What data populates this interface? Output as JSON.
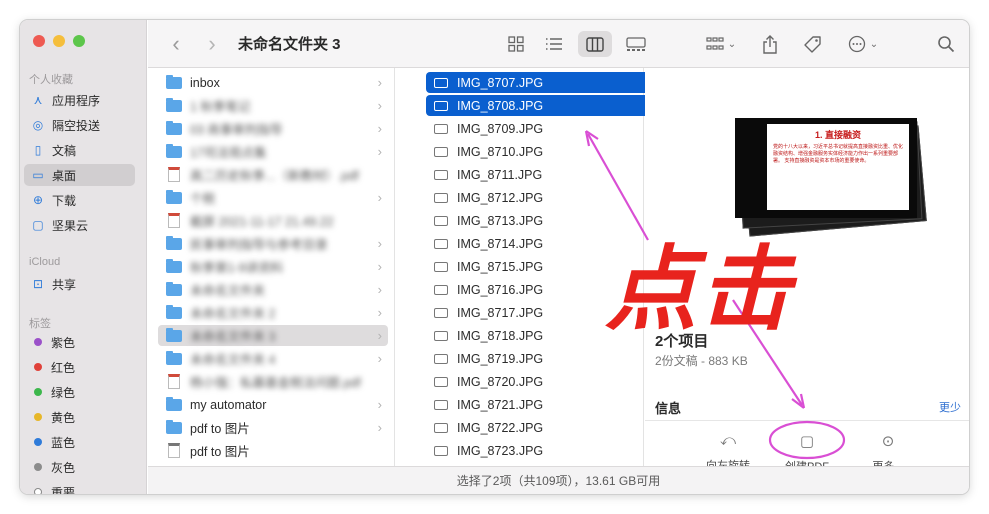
{
  "sidebar": {
    "favorites_header": "个人收藏",
    "favorites": [
      {
        "label": "应用程序",
        "icon": "apps-icon"
      },
      {
        "label": "隔空投送",
        "icon": "airdrop-icon"
      },
      {
        "label": "文稿",
        "icon": "document-icon"
      },
      {
        "label": "桌面",
        "icon": "desktop-icon"
      },
      {
        "label": "下载",
        "icon": "download-icon"
      },
      {
        "label": "坚果云",
        "icon": "folder-icon"
      }
    ],
    "icloud_header": "iCloud",
    "icloud": [
      {
        "label": "共享",
        "icon": "shared-folder-icon"
      }
    ],
    "tags_header": "标签",
    "tags": [
      {
        "label": "紫色",
        "color": "#9b51c9"
      },
      {
        "label": "红色",
        "color": "#e0413a"
      },
      {
        "label": "绿色",
        "color": "#3db74c"
      },
      {
        "label": "黄色",
        "color": "#e7b72a"
      },
      {
        "label": "蓝色",
        "color": "#2f7bd9"
      },
      {
        "label": "灰色",
        "color": "#8c8c8c"
      },
      {
        "label": "重要",
        "color": "#ffffff"
      }
    ]
  },
  "toolbar": {
    "title": "未命名文件夹 3"
  },
  "column1": [
    {
      "label": "inbox",
      "type": "folder",
      "blurred": false
    },
    {
      "label": "1 秋季笔记",
      "type": "folder",
      "blurred": true
    },
    {
      "label": "03 商事审判指导",
      "type": "folder",
      "blurred": true
    },
    {
      "label": "17司法观点集",
      "type": "folder",
      "blurred": true
    },
    {
      "label": "高二历史秋季...（新教材）.pdf",
      "type": "pdf",
      "blurred": true
    },
    {
      "label": "个税",
      "type": "folder",
      "blurred": true
    },
    {
      "label": "截屏 2021-11-17 21.49.22",
      "type": "pdf",
      "blurred": true
    },
    {
      "label": "民事审判指导与参考目录",
      "type": "folder",
      "blurred": true
    },
    {
      "label": "秋季第1-9讲资料",
      "type": "folder",
      "blurred": true
    },
    {
      "label": "未命名文件夹",
      "type": "folder",
      "blurred": true
    },
    {
      "label": "未命名文件夹 2",
      "type": "folder",
      "blurred": true
    },
    {
      "label": "未命名文件夹 3",
      "type": "folder",
      "blurred": true,
      "selected": true
    },
    {
      "label": "未命名文件夹 4",
      "type": "folder",
      "blurred": true
    },
    {
      "label": "杨小强：私募基金税法问题.pdf",
      "type": "pdf",
      "blurred": true
    },
    {
      "label": "my automator",
      "type": "folder",
      "blurred": false
    },
    {
      "label": "pdf to 图片",
      "type": "folder",
      "blurred": false
    },
    {
      "label": "pdf to 图片",
      "type": "app",
      "blurred": false
    }
  ],
  "column2": [
    {
      "label": "IMG_8707.JPG",
      "selected": true
    },
    {
      "label": "IMG_8708.JPG",
      "selected": true
    },
    {
      "label": "IMG_8709.JPG"
    },
    {
      "label": "IMG_8710.JPG"
    },
    {
      "label": "IMG_8711.JPG"
    },
    {
      "label": "IMG_8712.JPG"
    },
    {
      "label": "IMG_8713.JPG"
    },
    {
      "label": "IMG_8714.JPG"
    },
    {
      "label": "IMG_8715.JPG"
    },
    {
      "label": "IMG_8716.JPG"
    },
    {
      "label": "IMG_8717.JPG"
    },
    {
      "label": "IMG_8718.JPG"
    },
    {
      "label": "IMG_8719.JPG"
    },
    {
      "label": "IMG_8720.JPG"
    },
    {
      "label": "IMG_8721.JPG"
    },
    {
      "label": "IMG_8722.JPG"
    },
    {
      "label": "IMG_8723.JPG"
    }
  ],
  "preview": {
    "slide_title": "1. 直接融资",
    "slide_body": "党的十八大以来，习近平总书记就提高直接融资比重、优化融资结构、增强金融服务实体经济能力作出一系列重要部署。 支持直接融资是资本市场的重要使命。",
    "count_title": "2个项目",
    "count_sub": "2份文稿 - 883 KB",
    "info_label": "信息",
    "more_label": "更少",
    "actions": [
      {
        "label": "向左旋转",
        "icon": "rotate-left-icon"
      },
      {
        "label": "创建PDF",
        "icon": "create-pdf-icon"
      },
      {
        "label": "更多...",
        "icon": "more-circle-icon"
      }
    ]
  },
  "status": "选择了2项（共109项），13.61 GB可用",
  "annotation": {
    "text": "点击",
    "color": "#e8231d",
    "arrow_color": "#d94fd4"
  }
}
